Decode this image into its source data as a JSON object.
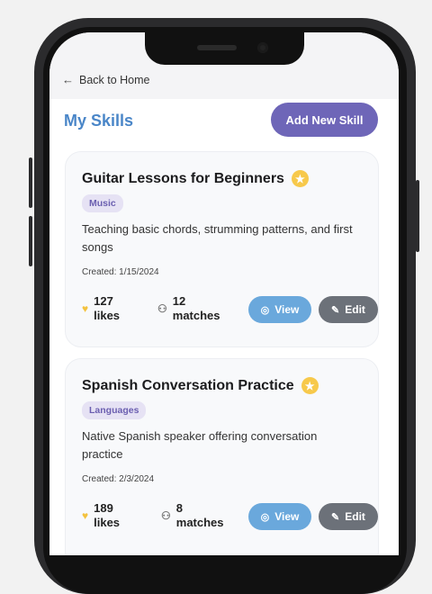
{
  "nav": {
    "back_label": "Back to Home"
  },
  "header": {
    "title": "My Skills",
    "add_button": "Add New Skill"
  },
  "skills": [
    {
      "title": "Guitar Lessons for Beginners",
      "category": "Music",
      "description": "Teaching basic chords, strumming patterns, and first songs",
      "created": "Created: 1/15/2024",
      "likes_count": "127",
      "likes_label": "likes",
      "matches_count": "12",
      "matches_label": "matches",
      "view_label": "View",
      "edit_label": "Edit"
    },
    {
      "title": "Spanish Conversation Practice",
      "category": "Languages",
      "description": "Native Spanish speaker offering conversation practice",
      "created": "Created: 2/3/2024",
      "likes_count": "189",
      "likes_label": "likes",
      "matches_count": "8",
      "matches_label": "matches",
      "view_label": "View",
      "edit_label": "Edit"
    }
  ],
  "colors": {
    "title": "#4a86c8",
    "add_button": "#6e66b8",
    "view_button": "#6aa8dc",
    "edit_button": "#6c7179",
    "star": "#f7c94b"
  }
}
